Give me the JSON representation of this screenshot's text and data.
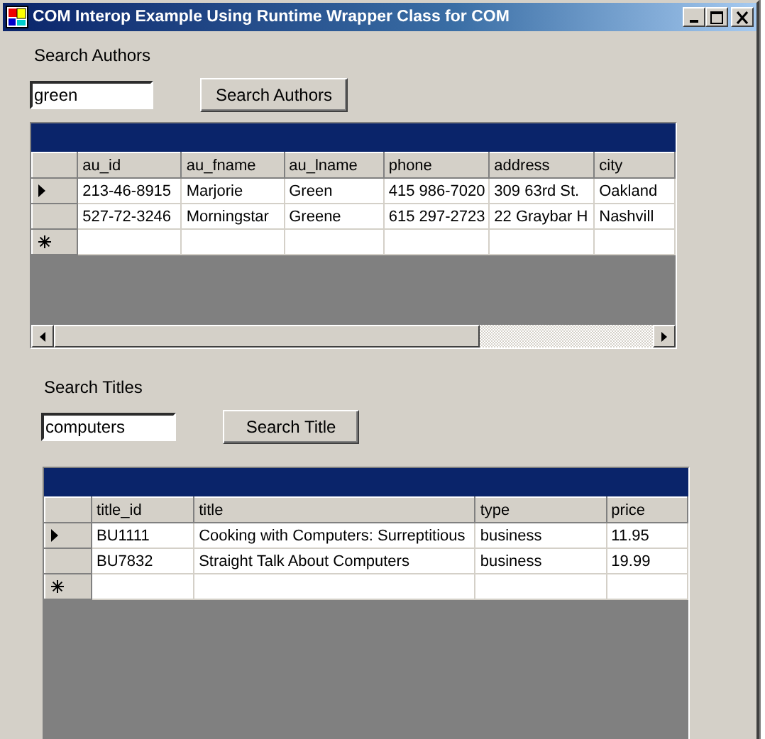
{
  "window": {
    "title": "COM Interop Example Using Runtime Wrapper Class for COM"
  },
  "authors_search": {
    "label": "Search Authors",
    "value": "green",
    "button": "Search Authors"
  },
  "authors_grid": {
    "columns": [
      "au_id",
      "au_fname",
      "au_lname",
      "phone",
      "address",
      "city"
    ],
    "rows": [
      {
        "selected": true,
        "cells": [
          "213-46-8915",
          "Marjorie",
          "Green",
          "415 986-7020",
          "309 63rd St.",
          "Oakland"
        ]
      },
      {
        "selected": false,
        "cells": [
          "527-72-3246",
          "Morningstar",
          "Greene",
          "615 297-2723",
          "22 Graybar H",
          "Nashvill"
        ]
      }
    ]
  },
  "titles_search": {
    "label": "Search Titles",
    "value": "computers",
    "button": "Search Title"
  },
  "titles_grid": {
    "columns": [
      "title_id",
      "title",
      "type",
      "price"
    ],
    "rows": [
      {
        "selected": true,
        "cells": [
          "BU1111",
          "Cooking with Computers: Surreptitious",
          "business",
          "11.95"
        ]
      },
      {
        "selected": false,
        "cells": [
          "BU7832",
          "Straight Talk About Computers",
          "business",
          "19.99"
        ]
      }
    ]
  }
}
